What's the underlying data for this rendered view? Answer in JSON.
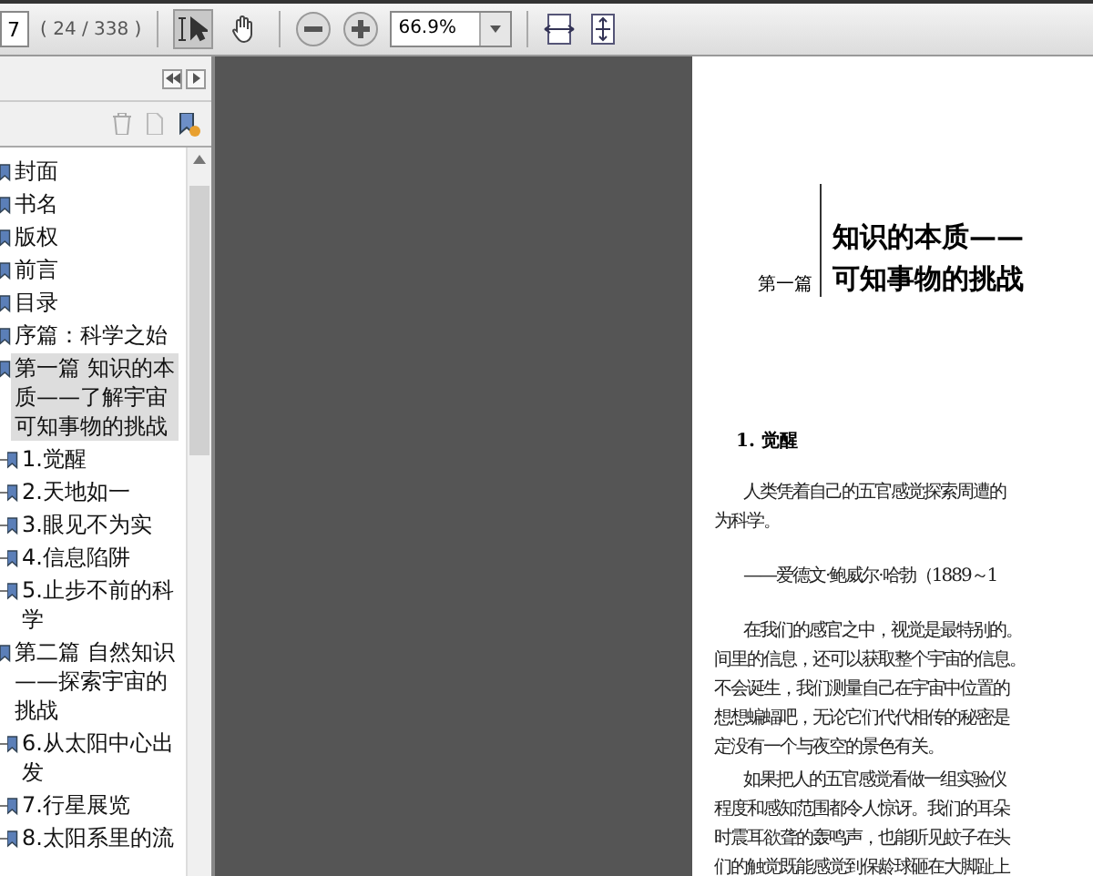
{
  "toolbar": {
    "page_number": "7",
    "page_count": "( 24 / 338 )",
    "tools": [
      {
        "kind": "select",
        "selected": true
      },
      {
        "kind": "hand",
        "selected": false
      }
    ],
    "zoom": "66.9%"
  },
  "bookmarks": [
    {
      "label": "封面",
      "selected": false
    },
    {
      "label": "书名",
      "selected": false
    },
    {
      "label": "版权",
      "selected": false
    },
    {
      "label": "前言",
      "selected": false
    },
    {
      "label": "目录",
      "selected": false
    },
    {
      "label": "序篇：科学之始",
      "selected": false
    },
    {
      "label": "第一篇 知识的本质——了解宇宙可知事物的挑战",
      "selected": true,
      "children": [
        {
          "label": "1.觉醒",
          "selected": false
        },
        {
          "label": "2.天地如一",
          "selected": false
        },
        {
          "label": "3.眼见不为实",
          "selected": false
        },
        {
          "label": "4.信息陷阱",
          "selected": false
        },
        {
          "label": "5.止步不前的科学",
          "selected": false
        }
      ]
    },
    {
      "label": "第二篇 自然知识——探索宇宙的挑战",
      "selected": false,
      "children": [
        {
          "label": "6.从太阳中心出发",
          "selected": false
        },
        {
          "label": "7.行星展览",
          "selected": false
        },
        {
          "label": "8.太阳系里的流",
          "selected": false
        }
      ]
    }
  ],
  "page": {
    "part_label": "第一篇",
    "title_lines": [
      "知识的本质——",
      "可知事物的挑战"
    ],
    "section_heading": "1. 觉醒",
    "paragraphs": [
      {
        "kind": "epigraph",
        "lines": [
          "人类凭着自己的五官感觉探索周遭的",
          "为科学。"
        ]
      },
      {
        "kind": "attribution",
        "lines": [
          "——爱德文·鲍威尔·哈勃（1889～1"
        ]
      },
      {
        "kind": "body",
        "lines": [
          "在我们的感官之中，视觉是最特别的。",
          "间里的信息，还可以获取整个宇宙的信息。",
          "不会诞生，我们测量自己在宇宙中位置的",
          "想想蝙蝠吧，无论它们代代相传的秘密是",
          "定没有一个与夜空的景色有关。"
        ]
      },
      {
        "kind": "body",
        "lines": [
          "如果把人的五官感觉看做一组实验仪",
          "程度和感知范围都令人惊讶。我们的耳朵",
          "时震耳欲聋的轰鸣声，也能听见蚊子在头",
          "们的触觉既能感觉到保龄球砸在大脚趾上"
        ]
      }
    ]
  }
}
